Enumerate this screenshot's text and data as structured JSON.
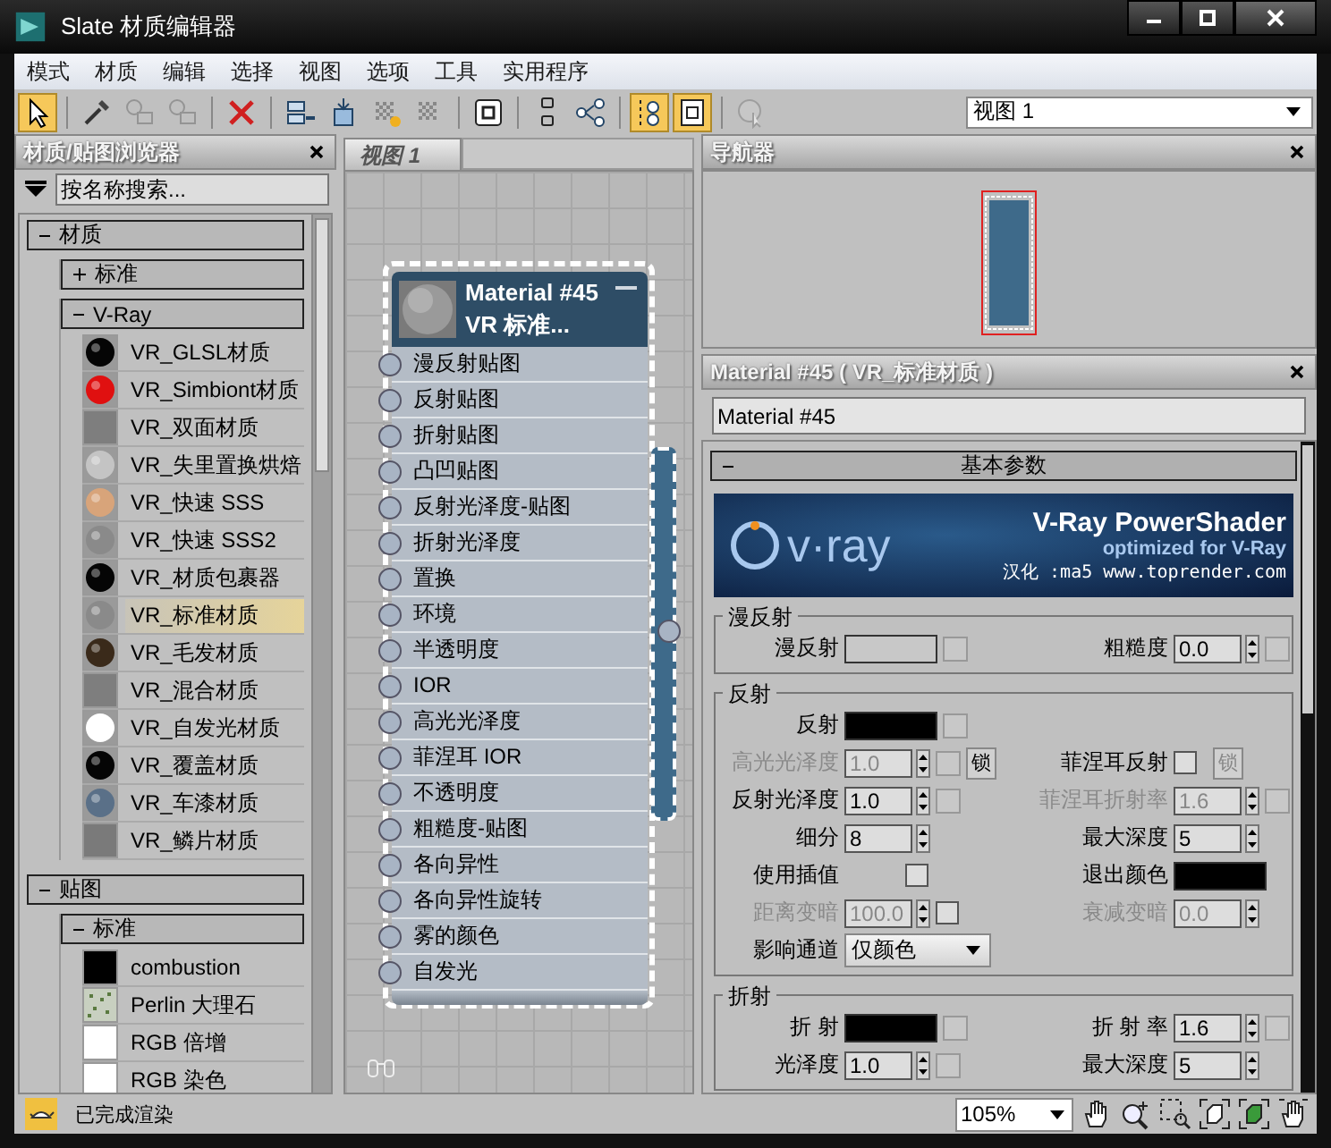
{
  "window": {
    "title": "Slate 材质编辑器"
  },
  "menu": [
    "模式",
    "材质",
    "编辑",
    "选择",
    "视图",
    "选项",
    "工具",
    "实用程序"
  ],
  "toolbar": {
    "groups": [
      [
        {
          "kind": "pointer",
          "selected": true,
          "disabled": false
        }
      ],
      [
        {
          "kind": "eyedropper",
          "selected": false,
          "disabled": false
        },
        {
          "kind": "pick",
          "selected": false,
          "disabled": true
        },
        {
          "kind": "assign",
          "selected": false,
          "disabled": true
        }
      ],
      [
        {
          "kind": "delete",
          "selected": false,
          "disabled": false
        }
      ],
      [
        {
          "kind": "move-children",
          "selected": false,
          "disabled": false
        },
        {
          "kind": "put",
          "selected": false,
          "disabled": false
        },
        {
          "kind": "checker-plus",
          "selected": false,
          "disabled": false
        },
        {
          "kind": "checker",
          "selected": false,
          "disabled": false
        }
      ],
      [
        {
          "kind": "sample",
          "selected": false,
          "disabled": false
        }
      ],
      [
        {
          "kind": "layout",
          "selected": false,
          "disabled": false
        },
        {
          "kind": "tree",
          "selected": false,
          "disabled": false
        }
      ],
      [
        {
          "kind": "tree-toggle",
          "selected": true,
          "disabled": false
        },
        {
          "kind": "params",
          "selected": true,
          "disabled": false
        }
      ],
      [
        {
          "kind": "render-pick",
          "selected": false,
          "disabled": true
        }
      ]
    ],
    "view_dropdown": "视图 1"
  },
  "browser": {
    "title": "材质/贴图浏览器",
    "search": {
      "placeholder": "按名称搜索..."
    },
    "sections": [
      {
        "label": "材质",
        "expanded": true,
        "groups": [
          {
            "label": "标准",
            "expanded": false
          },
          {
            "label": "V-Ray",
            "expanded": true,
            "items": [
              {
                "name": "VR_GLSL材质",
                "kind": "sphere",
                "color": "#050505",
                "selected": false
              },
              {
                "name": "VR_Simbiont材质",
                "kind": "sphere",
                "color": "#e01010",
                "selected": false
              },
              {
                "name": "VR_双面材质",
                "kind": "flat",
                "color": "#7e7e7e",
                "selected": false
              },
              {
                "name": "VR_失里置换烘焙",
                "kind": "sphere",
                "color": "#c4c4c4",
                "selected": false
              },
              {
                "name": "VR_快速 SSS",
                "kind": "sphere",
                "color": "#d8a47a",
                "selected": false
              },
              {
                "name": "VR_快速 SSS2",
                "kind": "sphere",
                "color": "#8a8a8a",
                "selected": false
              },
              {
                "name": "VR_材质包裹器",
                "kind": "sphere",
                "color": "#050505",
                "selected": false
              },
              {
                "name": "VR_标准材质",
                "kind": "sphere",
                "color": "#8a8a8a",
                "selected": true
              },
              {
                "name": "VR_毛发材质",
                "kind": "sphere",
                "color": "#3a2a1a",
                "selected": false
              },
              {
                "name": "VR_混合材质",
                "kind": "flat",
                "color": "#7e7e7e",
                "selected": false
              },
              {
                "name": "VR_自发光材质",
                "kind": "sphere",
                "color": "#ffffff",
                "selected": false
              },
              {
                "name": "VR_覆盖材质",
                "kind": "sphere",
                "color": "#050505",
                "selected": false
              },
              {
                "name": "VR_车漆材质",
                "kind": "sphere",
                "color": "#5a7088",
                "selected": false
              },
              {
                "name": "VR_鳞片材质",
                "kind": "flat",
                "color": "#7a7a7a",
                "selected": false
              }
            ]
          }
        ]
      },
      {
        "label": "贴图",
        "expanded": true,
        "groups": [
          {
            "label": "标准",
            "expanded": true,
            "items": [
              {
                "name": "combustion",
                "kind": "flat",
                "color": "#000000",
                "selected": false
              },
              {
                "name": "Perlin 大理石",
                "kind": "noise",
                "color": "#c8d0c0",
                "selected": false
              },
              {
                "name": "RGB 倍增",
                "kind": "flat",
                "color": "#ffffff",
                "selected": false
              },
              {
                "name": "RGB 染色",
                "kind": "flat",
                "color": "#ffffff",
                "selected": false
              }
            ]
          }
        ]
      }
    ]
  },
  "view": {
    "tab": "视图 1",
    "node": {
      "title": "Material #45",
      "subtitle": "VR 标准...",
      "expanded": true,
      "slots": [
        "漫反射贴图",
        "反射贴图",
        "折射贴图",
        "凸凹贴图",
        "反射光泽度-贴图",
        "折射光泽度",
        "置换",
        "环境",
        "半透明度",
        "IOR",
        "高光光泽度",
        "菲涅耳 IOR",
        "不透明度",
        "粗糙度-贴图",
        "各向异性",
        "各向异性旋转",
        "雾的颜色",
        "自发光"
      ]
    }
  },
  "navigator": {
    "title": "导航器"
  },
  "params": {
    "title": "Material #45 ( VR_标准材质 )",
    "name": "Material #45",
    "rollout": {
      "title": "基本参数",
      "expanded": true
    },
    "banner": {
      "logo": "v·ray",
      "title": "V-Ray PowerShader",
      "subtitle": "optimized for V-Ray",
      "credit": "汉化 :ma5 www.toprender.com"
    },
    "groups": [
      {
        "title": "漫反射",
        "rows": [
          {
            "left": {
              "label": "漫反射",
              "kind": "color",
              "color": "#c8c8c8",
              "disabled": false,
              "map": true
            },
            "right": {
              "label": "粗糙度",
              "kind": "spinner",
              "value": "0.0",
              "disabled": false,
              "map": true
            }
          }
        ]
      },
      {
        "title": "反射",
        "rows": [
          {
            "left": {
              "label": "反射",
              "kind": "color",
              "color": "#000000",
              "disabled": false,
              "map": true
            }
          },
          {
            "left": {
              "label": "高光光泽度",
              "kind": "spinner",
              "value": "1.0",
              "disabled": true,
              "map": true,
              "lock": {
                "label": "锁",
                "disabled": false
              }
            },
            "right": {
              "label": "菲涅耳反射",
              "kind": "checkbox",
              "checked": false,
              "disabled": false,
              "map": false,
              "lock": {
                "label": "锁",
                "disabled": true
              }
            }
          },
          {
            "left": {
              "label": "反射光泽度",
              "kind": "spinner",
              "value": "1.0",
              "disabled": false,
              "map": true
            },
            "right": {
              "label": "菲涅耳折射率",
              "kind": "spinner",
              "value": "1.6",
              "disabled": true,
              "map": true
            }
          },
          {
            "left": {
              "label": "细分",
              "kind": "spinner",
              "value": "8",
              "disabled": false,
              "map": false
            },
            "right": {
              "label": "最大深度",
              "kind": "spinner",
              "value": "5",
              "disabled": false,
              "map": false
            }
          },
          {
            "left": {
              "label": "使用插值",
              "kind": "checkbox",
              "checked": false,
              "disabled": false,
              "map": false
            },
            "right": {
              "label": "退出颜色",
              "kind": "color",
              "color": "#000000",
              "disabled": false,
              "map": false
            }
          },
          {
            "left": {
              "label": "距离变暗",
              "kind": "spinner",
              "value": "100.0",
              "disabled": true,
              "map": false,
              "check": {
                "checked": false
              }
            },
            "right": {
              "label": "衰减变暗",
              "kind": "spinner",
              "value": "0.0",
              "disabled": true,
              "map": false
            }
          },
          {
            "left": {
              "label": "影响通道",
              "kind": "dropdown",
              "value": "仅颜色",
              "disabled": false,
              "map": false
            }
          }
        ]
      },
      {
        "title": "折射",
        "rows": [
          {
            "left": {
              "label": "折 射",
              "kind": "color",
              "color": "#000000",
              "disabled": false,
              "map": true
            },
            "right": {
              "label": "折 射 率",
              "kind": "spinner",
              "value": "1.6",
              "disabled": false,
              "map": true
            }
          },
          {
            "left": {
              "label": "光泽度",
              "kind": "spinner",
              "value": "1.0",
              "disabled": false,
              "map": true
            },
            "right": {
              "label": "最大深度",
              "kind": "spinner",
              "value": "5",
              "disabled": false,
              "map": false
            }
          }
        ]
      }
    ]
  },
  "status_bar": {
    "message": "已完成渲染",
    "zoom": "105%"
  }
}
